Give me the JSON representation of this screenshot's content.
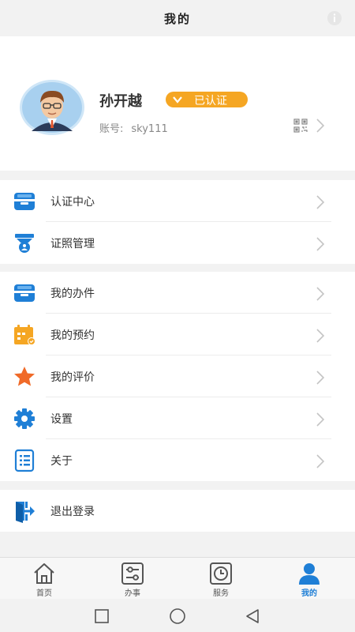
{
  "header": {
    "title": "我的",
    "info_icon": "info-icon"
  },
  "profile": {
    "name": "孙开越",
    "badge": "已认证",
    "account_label": "账号:",
    "account_value": "sky111"
  },
  "menu_groups": [
    {
      "items": [
        {
          "label": "认证中心",
          "icon": "id-card-icon"
        },
        {
          "label": "证照管理",
          "icon": "license-icon"
        }
      ]
    },
    {
      "items": [
        {
          "label": "我的办件",
          "icon": "folder-icon"
        },
        {
          "label": "我的预约",
          "icon": "calendar-icon"
        },
        {
          "label": "我的评价",
          "icon": "star-icon"
        },
        {
          "label": "设置",
          "icon": "gear-icon"
        },
        {
          "label": "关于",
          "icon": "document-icon"
        }
      ]
    },
    {
      "items": [
        {
          "label": "退出登录",
          "icon": "logout-icon"
        }
      ]
    }
  ],
  "tabbar": [
    {
      "label": "首页",
      "icon": "home-icon"
    },
    {
      "label": "办事",
      "icon": "sliders-icon"
    },
    {
      "label": "服务",
      "icon": "clock-icon"
    },
    {
      "label": "我的",
      "icon": "user-icon"
    }
  ],
  "colors": {
    "accent": "#1f7fd6",
    "badge": "#f5a623",
    "star": "#f06a28",
    "calendar": "#f5a623"
  }
}
